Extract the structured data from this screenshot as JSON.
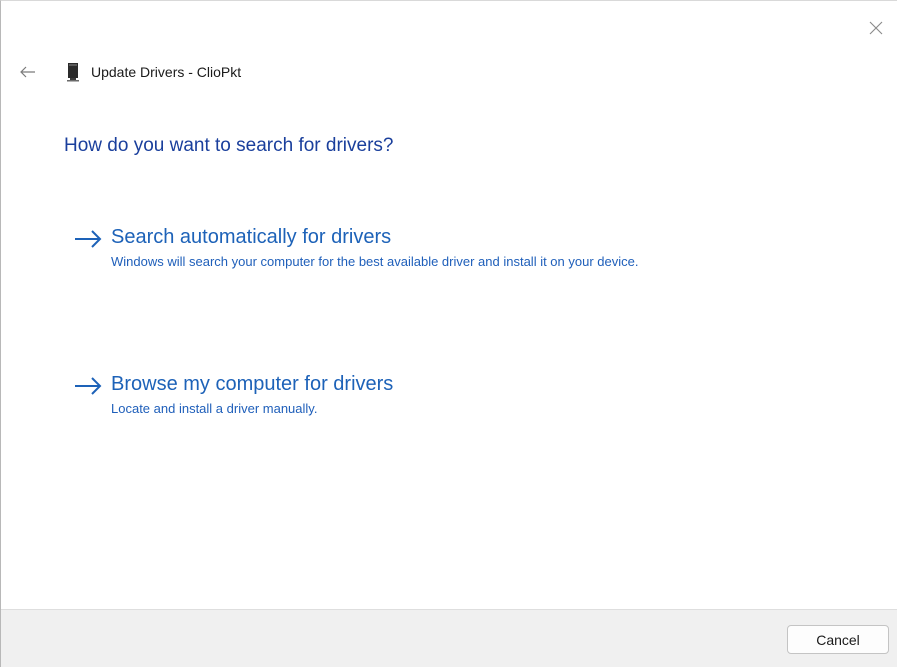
{
  "window": {
    "title": "Update Drivers - ClioPkt",
    "close_icon": "close-icon",
    "back_icon": "back-arrow-icon",
    "device_icon": "device-icon"
  },
  "main": {
    "heading": "How do you want to search for drivers?",
    "options": [
      {
        "title": "Search automatically for drivers",
        "description": "Windows will search your computer for the best available driver and install it on your device.",
        "icon": "arrow-right-icon"
      },
      {
        "title": "Browse my computer for drivers",
        "description": "Locate and install a driver manually.",
        "icon": "arrow-right-icon"
      }
    ]
  },
  "footer": {
    "cancel_label": "Cancel"
  },
  "colors": {
    "heading": "#1a3f9c",
    "link": "#1d62b8",
    "footer_bg": "#f0f0f0"
  }
}
